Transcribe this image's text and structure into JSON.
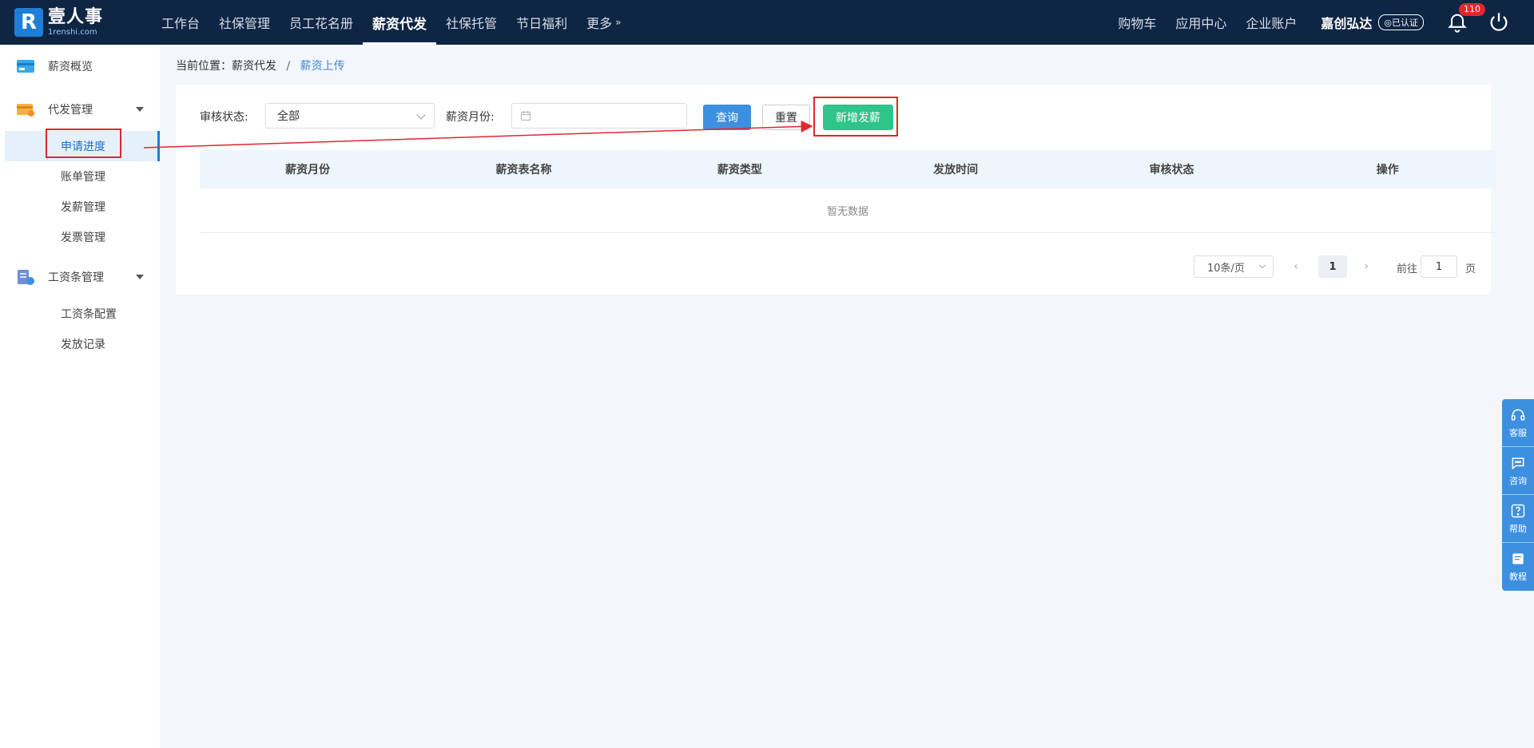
{
  "brand": {
    "name_cn": "壹人事",
    "name_en": "1renshi.com",
    "mark": "R"
  },
  "nav": {
    "items": [
      {
        "label": "工作台",
        "active": false
      },
      {
        "label": "社保管理",
        "active": false
      },
      {
        "label": "员工花名册",
        "active": false
      },
      {
        "label": "薪资代发",
        "active": true
      },
      {
        "label": "社保托管",
        "active": false
      },
      {
        "label": "节日福利",
        "active": false
      }
    ],
    "more_label": "更多",
    "more_glyph": "»"
  },
  "top_right": {
    "cart": "购物车",
    "app_center": "应用中心",
    "enterprise_account": "企业账户",
    "company": "嘉创弘达",
    "verified": "◎已认证",
    "notification_count": "110"
  },
  "sidebar": {
    "overview": "薪资概览",
    "group_daifa": {
      "label": "代发管理",
      "items": [
        "申请进度",
        "账单管理",
        "发薪管理",
        "发票管理"
      ]
    },
    "group_payslip": {
      "label": "工资条管理",
      "items": [
        "工资条配置",
        "发放记录"
      ]
    }
  },
  "breadcrumb": {
    "prefix": "当前位置：薪资代发",
    "sep": "/",
    "current": "薪资上传"
  },
  "filter": {
    "status_label": "审核状态:",
    "status_value": "全部",
    "month_label": "薪资月份:",
    "query_label": "查询",
    "reset_label": "重置",
    "add_label": "新增发薪"
  },
  "table": {
    "columns": [
      "薪资月份",
      "薪资表名称",
      "薪资类型",
      "发放时间",
      "审核状态",
      "操作"
    ],
    "empty_text": "暂无数据"
  },
  "pagination": {
    "page_size": "10条/页",
    "prev": "‹",
    "next": "›",
    "current_page": "1",
    "goto_label": "前往",
    "goto_value": "1",
    "page_suffix": "页"
  },
  "float_panel": {
    "service": "客服",
    "consult": "咨询",
    "help": "帮助",
    "tutorial": "教程"
  },
  "colors": {
    "topbar": "#0e2544",
    "primary": "#3d90e0",
    "success": "#2ec48a",
    "annotation": "#e0262e"
  }
}
